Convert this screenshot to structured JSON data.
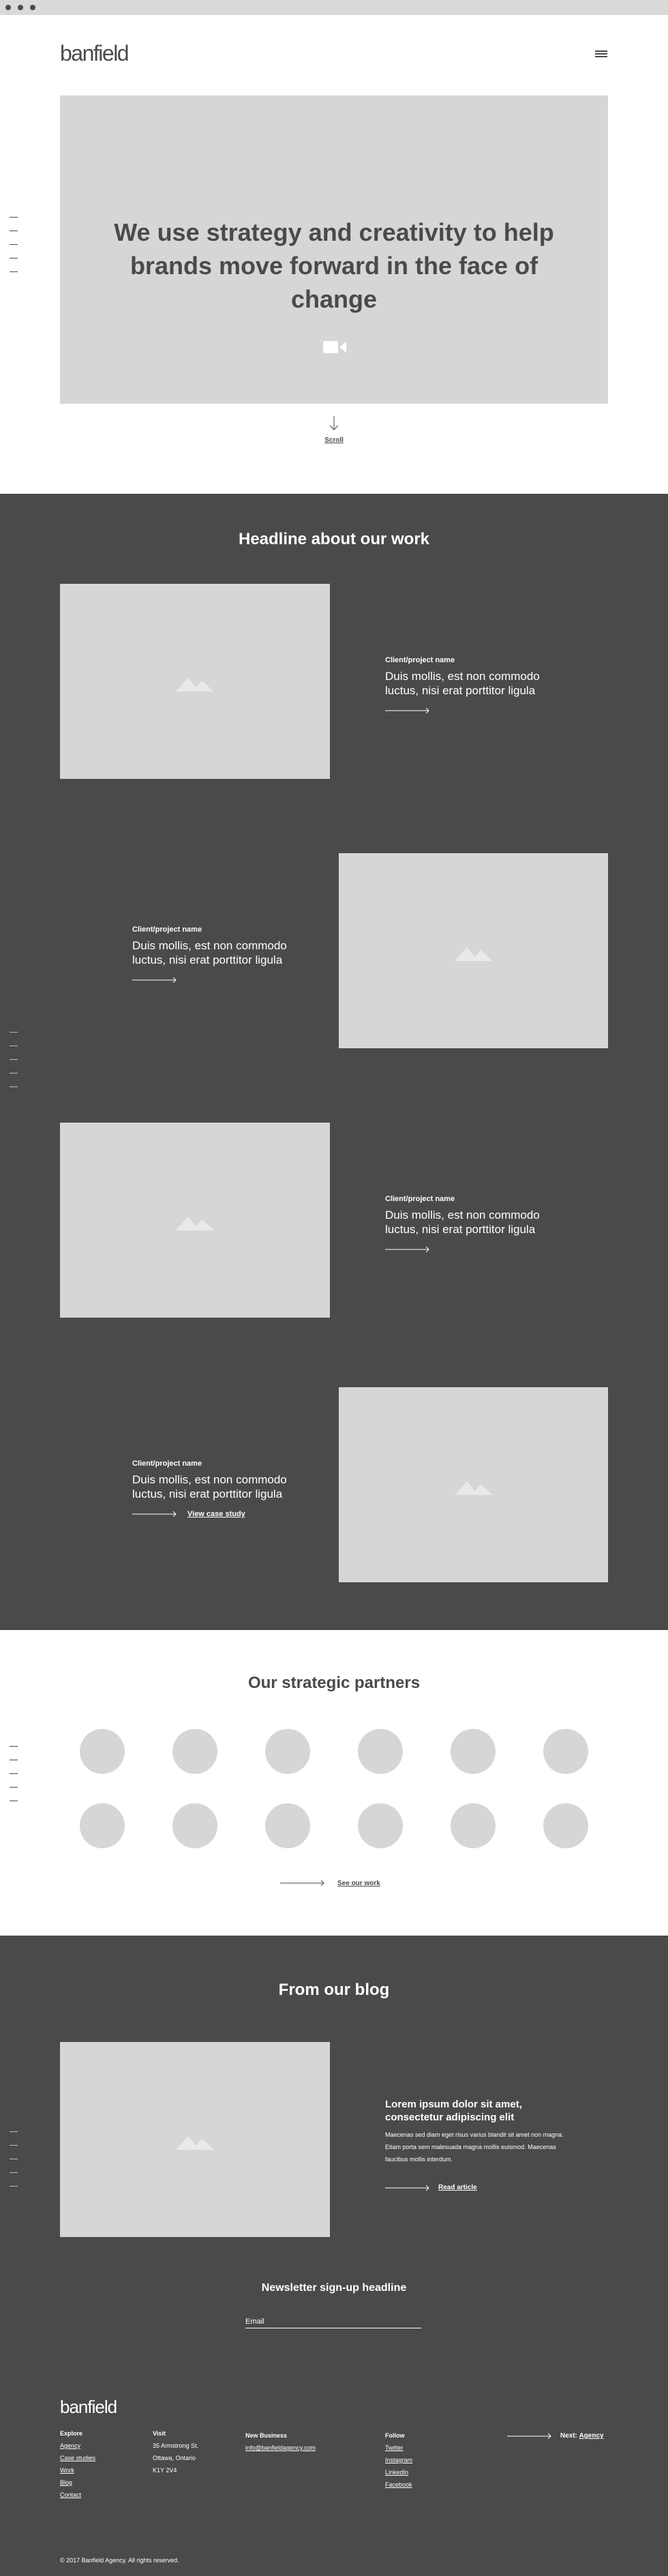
{
  "header": {
    "logo": "banfield",
    "menu_icon": "hamburger-icon"
  },
  "hero": {
    "title_line1": "We use strategy and creativity to help",
    "title_line2": "brands move forward in the face of change",
    "video_icon": "video-camera-icon",
    "scroll_label": "Scroll"
  },
  "work": {
    "headline": "Headline about our work",
    "items": [
      {
        "label": "Client/project name",
        "desc": "Duis mollis, est non commodo luctus, nisi erat porttitor ligula"
      },
      {
        "label": "Client/project name",
        "desc": "Duis mollis, est non commodo luctus, nisi erat porttitor ligula"
      },
      {
        "label": "Client/project name",
        "desc": "Duis mollis, est non commodo luctus, nisi erat porttitor ligula"
      },
      {
        "label": "Client/project name",
        "desc": "Duis mollis, est non commodo luctus, nisi erat porttitor ligula",
        "link": "View case study"
      }
    ]
  },
  "partners": {
    "headline": "Our strategic partners",
    "link": "See our work"
  },
  "blog": {
    "headline": "From our blog",
    "title": "Lorem ipsum dolor sit amet, consectetur adipiscing elit",
    "body": "Maecenas sed diam eget risus varius blandit sit amet non magna. Etiam porta sem malesuada magna mollis euismod. Maecenas faucibus mollis interdum.",
    "link": "Read article"
  },
  "newsletter": {
    "headline": "Newsletter sign-up headline",
    "email_label": "Email"
  },
  "footer": {
    "logo": "banfield",
    "explore": {
      "heading": "Explore",
      "links": [
        "Agency",
        "Case studies",
        "Work",
        "Blog",
        "Contact"
      ]
    },
    "visit": {
      "heading": "Visit",
      "lines": [
        "35 Armstrong St.",
        "Ottawa, Ontario",
        "K1Y 2V4"
      ]
    },
    "business": {
      "heading": "New Business",
      "email": "info@banfieldagency.com"
    },
    "follow": {
      "heading": "Follow",
      "links": [
        "Twitter",
        "Instagram",
        "LinkedIn",
        "Facebook"
      ]
    },
    "next_label": "Next:",
    "next_link": "Agency",
    "copyright": "© 2017 Banfield Agency. All rights reserved."
  }
}
